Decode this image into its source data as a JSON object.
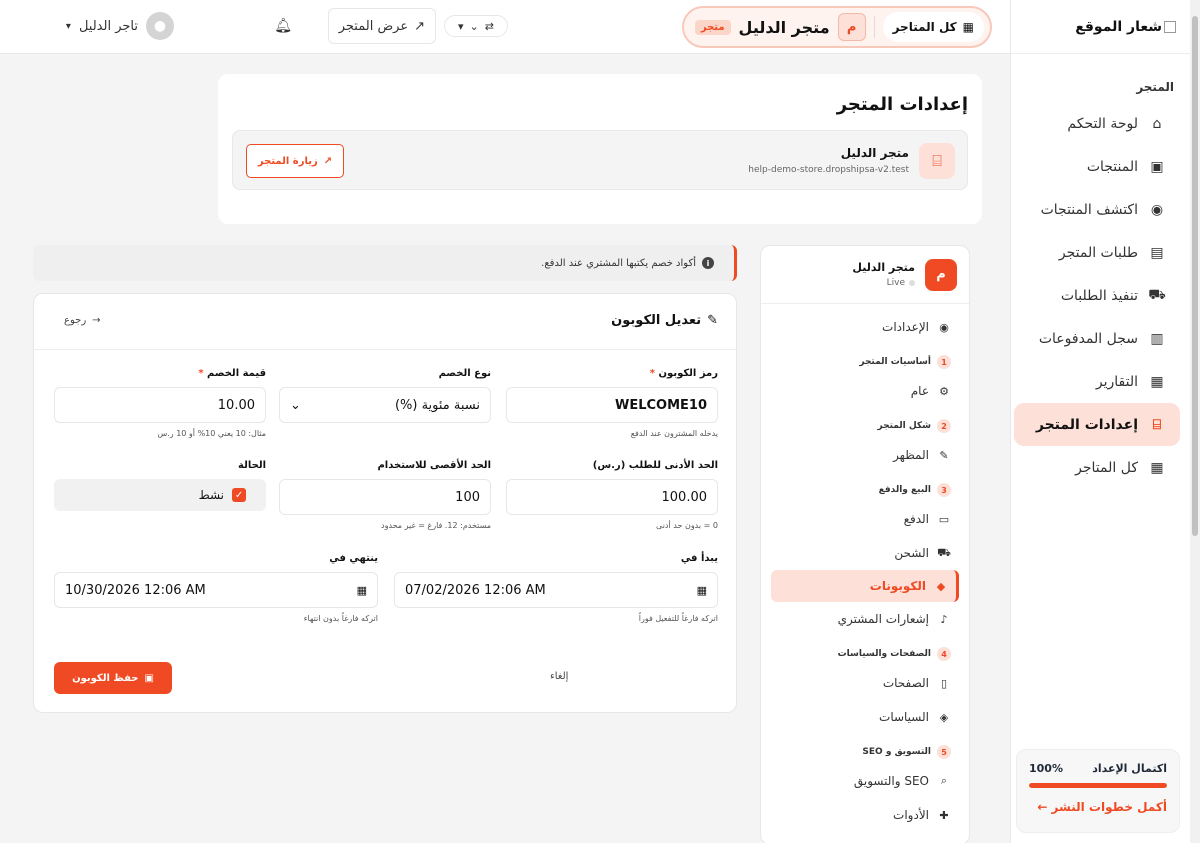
{
  "sidebar": {
    "logo_text": "شعار الموقع",
    "section_label": "المتجر",
    "items": [
      {
        "label": "لوحة التحكم",
        "icon": "home-icon",
        "glyph": "⌂"
      },
      {
        "label": "المنتجات",
        "icon": "box-icon",
        "glyph": "▣"
      },
      {
        "label": "اكتشف المنتجات",
        "icon": "compass-icon",
        "glyph": "◉"
      },
      {
        "label": "طلبات المتجر",
        "icon": "receipt-icon",
        "glyph": "▤"
      },
      {
        "label": "تنفيذ الطلبات",
        "icon": "truck-icon",
        "glyph": "⛟"
      },
      {
        "label": "سجل المدفوعات",
        "icon": "money-icon",
        "glyph": "▥"
      },
      {
        "label": "التقارير",
        "icon": "chart-icon",
        "glyph": "▦"
      },
      {
        "label": "إعدادات المتجر",
        "icon": "store-icon",
        "glyph": "⌸"
      },
      {
        "label": "كل المتاجر",
        "icon": "grid-icon",
        "glyph": "▦"
      }
    ],
    "progress": {
      "label": "اكتمال الإعداد",
      "percent_text": "100%",
      "value": 100,
      "link": "أكمل خطوات النشر ←"
    }
  },
  "topbar": {
    "all_stores": "كل المتاجر",
    "store_initial": "م",
    "store_name": "متجر الدليل",
    "store_badge": "متجر",
    "view_store": "عرض المتجر",
    "user_name": "تاجر الدليل"
  },
  "header": {
    "title": "إعدادات المتجر",
    "store_name": "متجر الدليل",
    "store_url": "help-demo-store.dropshipsa-v2.test",
    "visit_label": "زيارة المتجر"
  },
  "store_menu": {
    "initial": "م",
    "name": "متجر الدليل",
    "status": "Live",
    "top_item": "الإعدادات",
    "groups": [
      {
        "num": "1",
        "label": "أساسيات المتجر",
        "items": [
          {
            "label": "عام",
            "icon": "gear-icon",
            "glyph": "⚙"
          }
        ]
      },
      {
        "num": "2",
        "label": "شكل المتجر",
        "items": [
          {
            "label": "المظهر",
            "icon": "brush-icon",
            "glyph": "✎"
          }
        ]
      },
      {
        "num": "3",
        "label": "البيع والدفع",
        "items": [
          {
            "label": "الدفع",
            "icon": "card-icon",
            "glyph": "▭"
          },
          {
            "label": "الشحن",
            "icon": "truck-icon",
            "glyph": "⛟"
          },
          {
            "label": "الكوبونات",
            "icon": "tag-icon",
            "glyph": "◆"
          },
          {
            "label": "إشعارات المشتري",
            "icon": "bell-icon",
            "glyph": "♪"
          }
        ]
      },
      {
        "num": "4",
        "label": "الصفحات والسياسات",
        "items": [
          {
            "label": "الصفحات",
            "icon": "file-icon",
            "glyph": "▯"
          },
          {
            "label": "السياسات",
            "icon": "shield-icon",
            "glyph": "◈"
          }
        ]
      },
      {
        "num": "5",
        "label": "التسويق و SEO",
        "items": [
          {
            "label": "SEO والتسويق",
            "icon": "search-icon",
            "glyph": "⌕"
          },
          {
            "label": "الأدوات",
            "icon": "puzzle-icon",
            "glyph": "✚"
          }
        ]
      }
    ]
  },
  "info": "أكواد خصم يكتبها المشتري عند الدفع.",
  "form": {
    "title": "تعديل الكوبون",
    "back": "رجوع",
    "code_label": "رمز الكوبون",
    "code_value": "WELCOME10",
    "code_hint": "يدخله المشترون عند الدفع",
    "type_label": "نوع الخصم",
    "type_value": "نسبة مئوية (%)",
    "value_label": "قيمة الخصم",
    "value_value": "10.00",
    "value_hint": "مثال: 10 يعني 10% أو 10 ر.س",
    "min_label": "الحد الأدنى للطلب (ر.س)",
    "min_value": "100.00",
    "min_hint": "0 = بدون حد أدنى",
    "max_label": "الحد الأقصى للاستخدام",
    "max_value": "100",
    "max_hint": "مستخدم: 12. فارغ = غير محدود",
    "status_label": "الحالة",
    "status_value": "نشط",
    "start_label": "يبدأ في",
    "start_value": "07/02/2026 12:06 AM",
    "start_hint": "اتركه فارغاً للتفعيل فوراً",
    "end_label": "ينتهي في",
    "end_value": "10/30/2026 12:06 AM",
    "end_hint": "اتركه فارغاً بدون انتهاء",
    "cancel": "إلغاء",
    "save": "حفظ الكوبون"
  }
}
